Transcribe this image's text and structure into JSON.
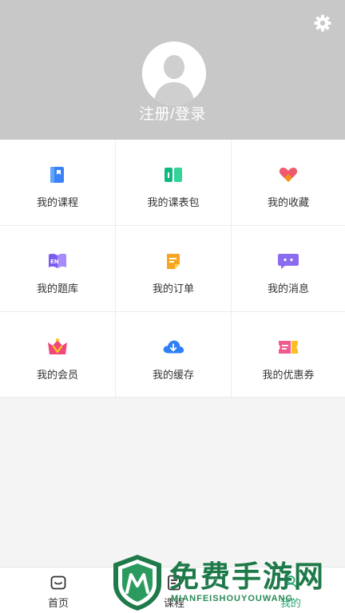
{
  "header": {
    "login_label": "注册/登录",
    "settings_icon": "gear-icon",
    "avatar_icon": "user-silhouette-icon"
  },
  "grid": {
    "items": [
      {
        "label": "我的课程",
        "icon": "notebook-icon",
        "color": "#3b82f6"
      },
      {
        "label": "我的课表包",
        "icon": "book-open-icon",
        "color": "#10b981"
      },
      {
        "label": "我的收藏",
        "icon": "heart-icon",
        "color": "#f05a6e"
      },
      {
        "label": "我的题库",
        "icon": "en-book-icon",
        "color": "#7c5cf0"
      },
      {
        "label": "我的订单",
        "icon": "order-note-icon",
        "color": "#f6a623"
      },
      {
        "label": "我的消息",
        "icon": "message-icon",
        "color": "#7c5cf0"
      },
      {
        "label": "我的会员",
        "icon": "vip-crown-icon",
        "color": "#f0487a"
      },
      {
        "label": "我的缓存",
        "icon": "cloud-download-icon",
        "color": "#2f7ff5"
      },
      {
        "label": "我的优惠券",
        "icon": "coupon-icon",
        "color": "#f05a8c"
      }
    ]
  },
  "tabbar": {
    "tabs": [
      {
        "label": "首页",
        "icon": "home-icon"
      },
      {
        "label": "课程",
        "icon": "course-icon"
      },
      {
        "label": "我的",
        "icon": "profile-icon"
      }
    ]
  },
  "watermark": {
    "title": "免费手游网",
    "subtitle": "MIANFEISHOUYOUWANG"
  }
}
